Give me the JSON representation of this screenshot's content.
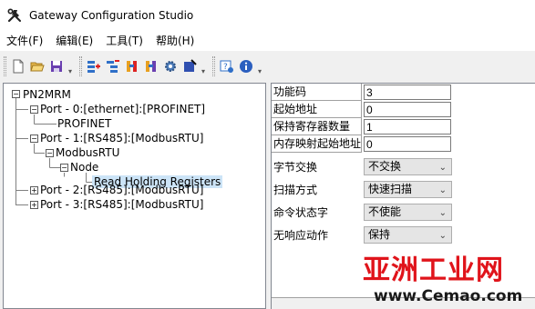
{
  "window": {
    "title": "Gateway Configuration Studio",
    "icon": "hammer-wrench-icon"
  },
  "menu": [
    {
      "label": "文件(F)"
    },
    {
      "label": "编辑(E)"
    },
    {
      "label": "工具(T)"
    },
    {
      "label": "帮助(H)"
    }
  ],
  "toolbar": {
    "groups": [
      [
        "new-file-icon",
        "open-folder-icon",
        "save-icon"
      ],
      [
        "add-port-icon",
        "add-device-icon",
        "add-command-icon",
        "variable-icon",
        "settings-gear-icon",
        "download-icon"
      ],
      [
        "about-icon",
        "info-icon"
      ]
    ]
  },
  "tree": {
    "nodes": [
      {
        "label": "PN2MRM",
        "expander": "-"
      },
      {
        "label": "Port - 0:[ethernet]:[PROFINET]",
        "expander": "-"
      },
      {
        "label": "PROFINET",
        "expander": ""
      },
      {
        "label": "Port - 1:[RS485]:[ModbusRTU]",
        "expander": "-"
      },
      {
        "label": "ModbusRTU",
        "expander": "-"
      },
      {
        "label": "Node",
        "expander": "-"
      },
      {
        "label": "Read Holding Registers",
        "expander": "",
        "selected": true
      },
      {
        "label": "Port - 2:[RS485]:[ModbusRTU]",
        "expander": "+"
      },
      {
        "label": "Port - 3:[RS485]:[ModbusRTU]",
        "expander": "+"
      }
    ]
  },
  "properties": {
    "rows": [
      {
        "key": "功能码",
        "value": "3",
        "kind": "text"
      },
      {
        "key": "起始地址",
        "value": "0",
        "kind": "text"
      },
      {
        "key": "保持寄存器数量",
        "value": "1",
        "kind": "text"
      },
      {
        "key": "内存映射起始地址",
        "value": "0",
        "kind": "text"
      },
      {
        "key": "字节交换",
        "value": "不交换",
        "kind": "select"
      },
      {
        "key": "扫描方式",
        "value": "快速扫描",
        "kind": "select"
      },
      {
        "key": "命令状态字",
        "value": "不使能",
        "kind": "select"
      },
      {
        "key": "无响应动作",
        "value": "保持",
        "kind": "select"
      }
    ]
  },
  "watermark": {
    "logo": "亚洲工业网",
    "url": "www.Cemao.com"
  }
}
